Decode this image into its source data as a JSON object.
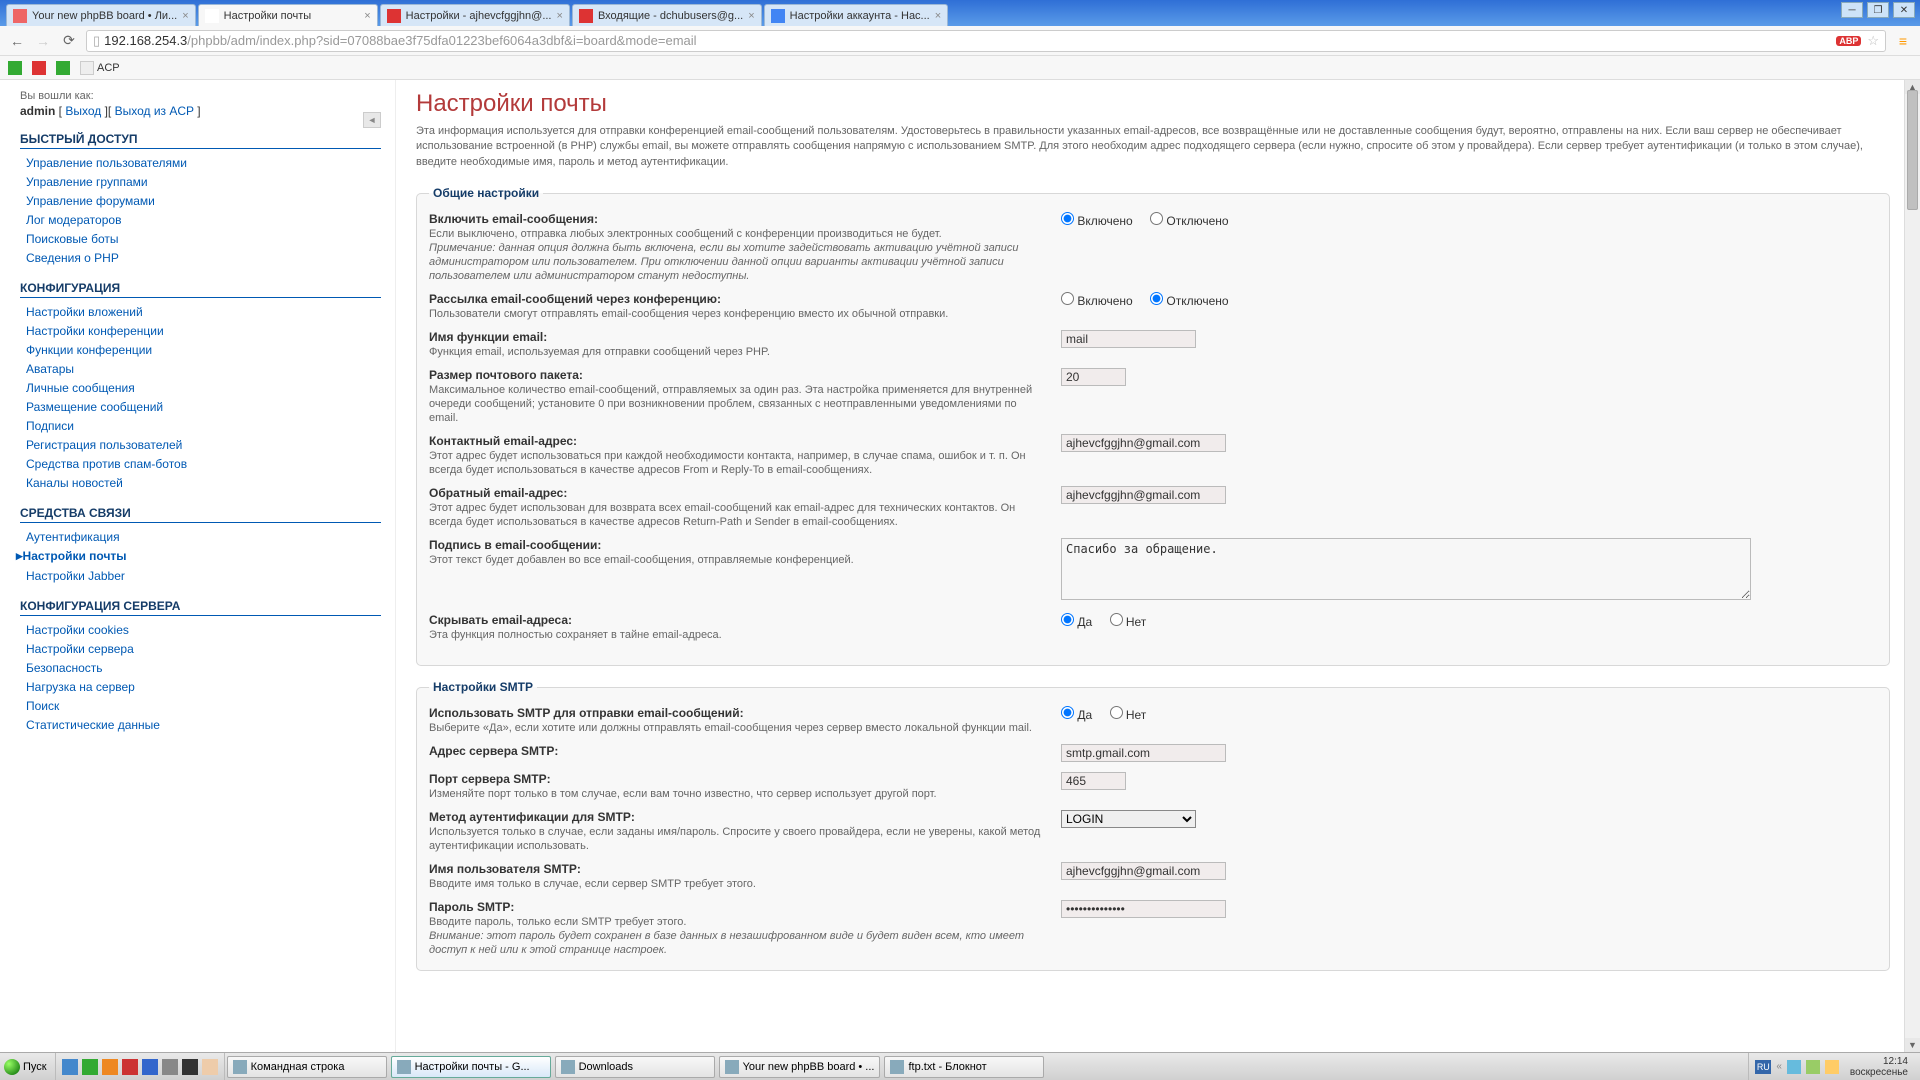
{
  "tabs": [
    {
      "t": "Your new phpBB board • Ли..."
    },
    {
      "t": "Настройки почты",
      "active": true
    },
    {
      "t": "Настройки - ajhevcfggjhn@..."
    },
    {
      "t": "Входящие - dchubusers@g..."
    },
    {
      "t": "Настройки аккаунта - Нас..."
    }
  ],
  "url_host": "192.168.254.3",
  "url_path": "/phpbb/adm/index.php?sid=07088bae3f75dfa01223bef6064a3dbf&i=board&mode=email",
  "bookmarks_bar": {
    "acp_label": "ACP"
  },
  "login": {
    "logged_as": "Вы вошли как:",
    "name": "admin",
    "logout": "Выход",
    "logout_acp": "Выход из ACP"
  },
  "sections": {
    "quick": {
      "h": "БЫСТРЫЙ ДОСТУП",
      "items": [
        "Управление пользователями",
        "Управление группами",
        "Управление форумами",
        "Лог модераторов",
        "Поисковые боты",
        "Сведения о PHP"
      ]
    },
    "conf": {
      "h": "КОНФИГУРАЦИЯ",
      "items": [
        "Настройки вложений",
        "Настройки конференции",
        "Функции конференции",
        "Аватары",
        "Личные сообщения",
        "Размещение сообщений",
        "Подписи",
        "Регистрация пользователей",
        "Средства против спам-ботов",
        "Каналы новостей"
      ]
    },
    "comm": {
      "h": "СРЕДСТВА СВЯЗИ",
      "items": [
        "Аутентификация",
        "Настройки почты",
        "Настройки Jabber"
      ],
      "active": 1
    },
    "srv": {
      "h": "КОНФИГУРАЦИЯ СЕРВЕРА",
      "items": [
        "Настройки cookies",
        "Настройки сервера",
        "Безопасность",
        "Нагрузка на сервер",
        "Поиск",
        "Статистические данные"
      ]
    }
  },
  "page": {
    "title": "Настройки почты",
    "desc": "Эта информация используется для отправки конференцией email-сообщений пользователям. Удостоверьтесь в правильности указанных email-адресов, все возвращённые или не доставленные сообщения будут, вероятно, отправлены на них. Если ваш сервер не обеспечивает использование встроенной (в PHP) службы email, вы можете отправлять сообщения напрямую с использованием SMTP. Для этого необходим адрес подходящего сервера (если нужно, спросите об этом у провайдера). Если сервер требует аутентификации (и только в этом случае), введите необходимые имя, пароль и метод аутентификации."
  },
  "labels": {
    "on": "Включено",
    "off": "Отключено",
    "yes": "Да",
    "no": "Нет"
  },
  "g1": {
    "legend": "Общие настройки",
    "enable": {
      "t": "Включить email-сообщения:",
      "d": "Если выключено, отправка любых электронных сообщений с конференции производиться не будет.",
      "n": "Примечание: данная опция должна быть включена, если вы хотите задействовать активацию учётной записи администратором или пользователем. При отключении данной опции варианты активации учётной записи пользователем или администратором станут недоступны."
    },
    "boardmail": {
      "t": "Рассылка email-сообщений через конференцию:",
      "d": "Пользователи смогут отправлять email-сообщения через конференцию вместо их обычной отправки."
    },
    "func": {
      "t": "Имя функции email:",
      "d": "Функция email, используемая для отправки сообщений через PHP.",
      "v": "mail"
    },
    "pkg": {
      "t": "Размер почтового пакета:",
      "d": "Максимальное количество email-сообщений, отправляемых за один раз. Эта настройка применяется для внутренней очереди сообщений; установите 0 при возникновении проблем, связанных с неотправленными уведомлениями по email.",
      "v": "20"
    },
    "contact": {
      "t": "Контактный email-адрес:",
      "d": "Этот адрес будет использоваться при каждой необходимости контакта, например, в случае спама, ошибок и т. п. Он всегда будет использоваться в качестве адресов From и Reply-To в email-сообщениях.",
      "v": "ajhevcfggjhn@gmail.com"
    },
    "ret": {
      "t": "Обратный email-адрес:",
      "d": "Этот адрес будет использован для возврата всех email-сообщений как email-адрес для технических контактов. Он всегда будет использоваться в качестве адресов Return-Path и Sender в email-сообщениях.",
      "v": "ajhevcfggjhn@gmail.com"
    },
    "sig": {
      "t": "Подпись в email-сообщении:",
      "d": "Этот текст будет добавлен во все email-сообщения, отправляемые конференцией.",
      "v": "Спасибо за обращение."
    },
    "hide": {
      "t": "Скрывать email-адреса:",
      "d": "Эта функция полностью сохраняет в тайне email-адреса."
    }
  },
  "g2": {
    "legend": "Настройки SMTP",
    "use": {
      "t": "Использовать SMTP для отправки email-сообщений:",
      "d": "Выберите «Да», если хотите или должны отправлять email-сообщения через сервер вместо локальной функции mail."
    },
    "host": {
      "t": "Адрес сервера SMTP:",
      "v": "smtp.gmail.com"
    },
    "port": {
      "t": "Порт сервера SMTP:",
      "d": "Изменяйте порт только в том случае, если вам точно известно, что сервер использует другой порт.",
      "v": "465"
    },
    "auth": {
      "t": "Метод аутентификации для SMTP:",
      "d": "Используется только в случае, если заданы имя/пароль. Спросите у своего провайдера, если не уверены, какой метод аутентификации использовать.",
      "v": "LOGIN"
    },
    "user": {
      "t": "Имя пользователя SMTP:",
      "d": "Вводите имя только в случае, если сервер SMTP требует этого.",
      "v": "ajhevcfggjhn@gmail.com"
    },
    "pass": {
      "t": "Пароль SMTP:",
      "d": "Вводите пароль, только если SMTP требует этого.",
      "w": "Внимание: этот пароль будет сохранен в базе данных в незашифрованном виде и будет виден всем, кто имеет доступ к ней или к этой странице настроек.",
      "v": "●●●●●●●●●●●●●●"
    }
  },
  "taskbar": {
    "start": "Пуск",
    "tasks": [
      {
        "t": "Командная строка"
      },
      {
        "t": "Настройки почты - G...",
        "active": true
      },
      {
        "t": "Downloads"
      },
      {
        "t": "Your new phpBB board • ..."
      },
      {
        "t": "ftp.txt - Блокнот"
      }
    ],
    "lang": "RU",
    "time": "12:14",
    "day": "воскресенье"
  }
}
